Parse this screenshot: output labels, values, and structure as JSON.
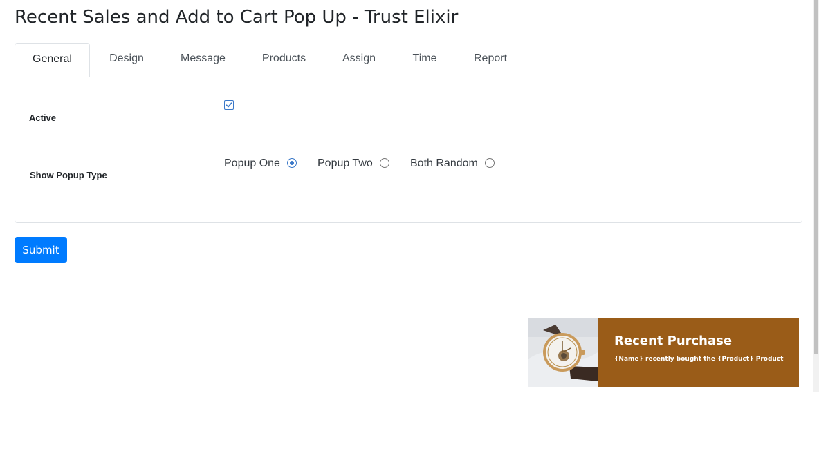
{
  "page": {
    "title": "Recent Sales and Add to Cart Pop Up - Trust Elixir"
  },
  "tabs": [
    {
      "label": "General",
      "active": true
    },
    {
      "label": "Design"
    },
    {
      "label": "Message"
    },
    {
      "label": "Products"
    },
    {
      "label": "Assign"
    },
    {
      "label": "Time"
    },
    {
      "label": "Report"
    }
  ],
  "general": {
    "active_label": "Active",
    "active_checked": true,
    "popup_type_label": "Show Popup Type",
    "popup_options": [
      {
        "label": "Popup One",
        "selected": true
      },
      {
        "label": "Popup Two",
        "selected": false
      },
      {
        "label": "Both Random",
        "selected": false
      }
    ]
  },
  "submit_label": "Submit",
  "popup_preview": {
    "title": "Recent Purchase",
    "message": "{Name} recently bought the {Product} Product",
    "background_color": "#9a5c18",
    "image_icon": "watch-image"
  },
  "colors": {
    "primary": "#007bff",
    "border": "#dee2e6",
    "accent": "#3a78c8"
  }
}
